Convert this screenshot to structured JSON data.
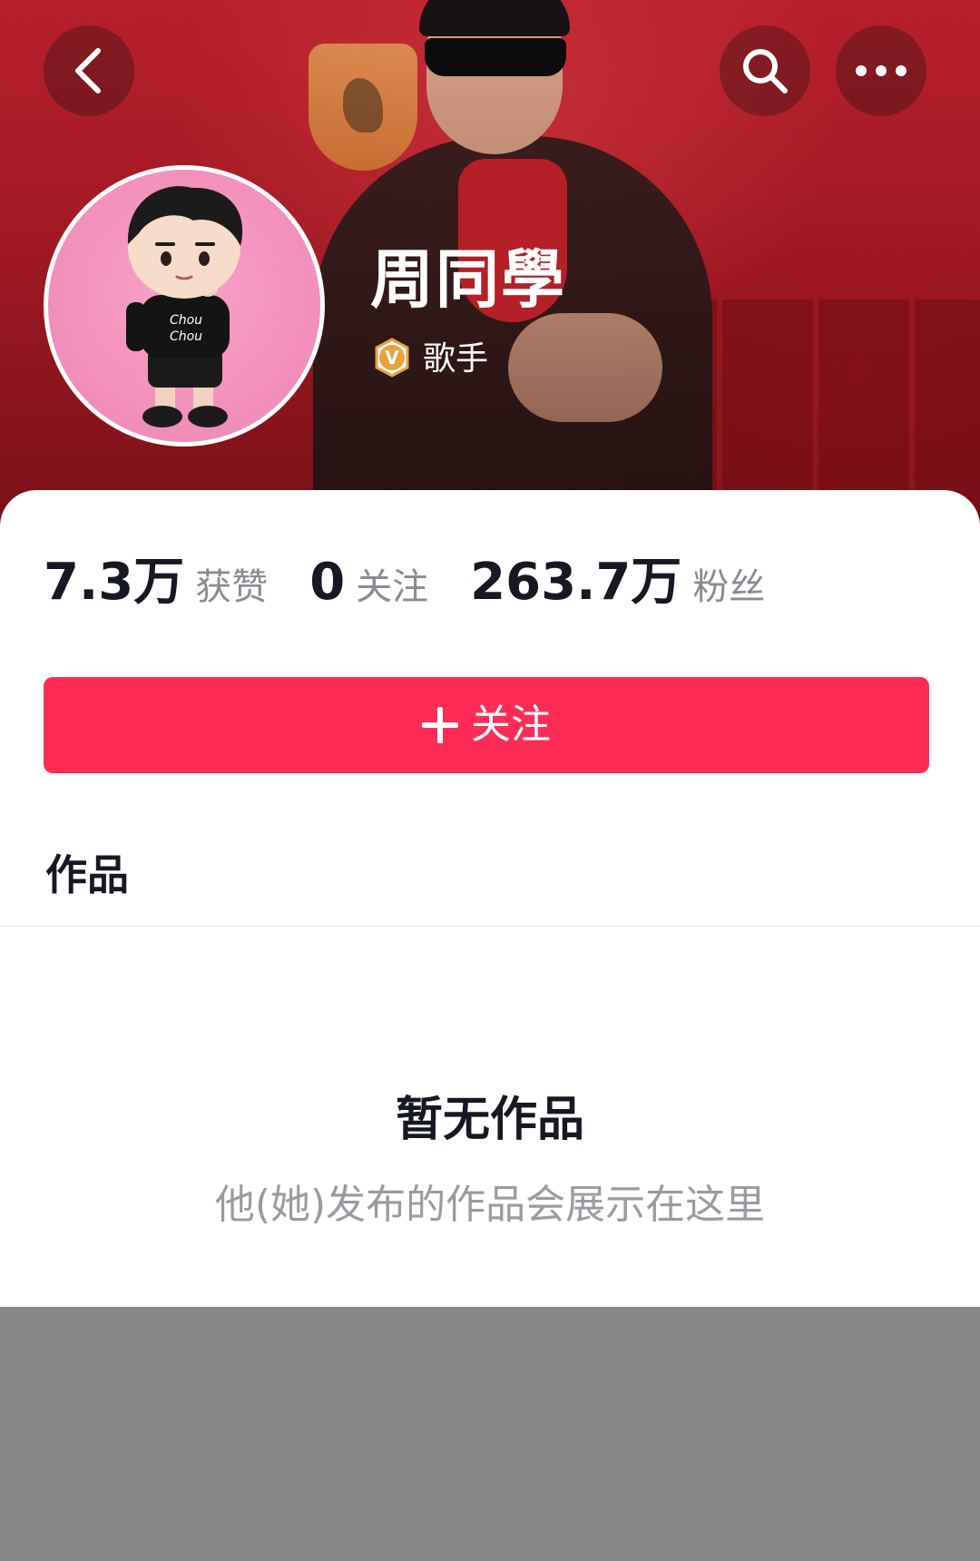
{
  "header": {
    "back_icon": "chevron-left-icon",
    "search_icon": "search-icon",
    "more_icon": "more-horizontal-icon"
  },
  "profile": {
    "name": "周同學",
    "role": "歌手",
    "verified_badge": "V",
    "verified_color": "#e9a23b"
  },
  "stats": [
    {
      "value": "7.3万",
      "label": "获赞"
    },
    {
      "value": "0",
      "label": "关注"
    },
    {
      "value": "263.7万",
      "label": "粉丝"
    }
  ],
  "follow_button": {
    "label": "关注",
    "color": "#fe2c55"
  },
  "tabs": {
    "works": "作品"
  },
  "empty_state": {
    "title": "暂无作品",
    "subtitle": "他(她)发布的作品会展示在这里"
  },
  "colors": {
    "cover_red": "#a51a23",
    "text_dark": "#161823",
    "text_muted": "#8a8b91",
    "overlay_gray": "#888888"
  }
}
